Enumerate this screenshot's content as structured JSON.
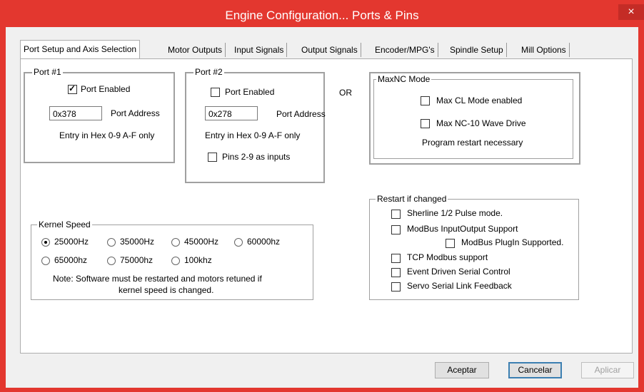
{
  "window": {
    "title": "Engine Configuration... Ports & Pins",
    "close_glyph": "×"
  },
  "tabs": [
    {
      "label": "Port Setup and Axis Selection",
      "active": true
    },
    {
      "label": "Motor Outputs"
    },
    {
      "label": "Input Signals"
    },
    {
      "label": "Output Signals"
    },
    {
      "label": "Encoder/MPG's"
    },
    {
      "label": "Spindle Setup"
    },
    {
      "label": "Mill Options"
    }
  ],
  "port1": {
    "legend": "Port #1",
    "enabled_label": "Port Enabled",
    "enabled": true,
    "address": "0x378",
    "address_label": "Port Address",
    "hint": "Entry in Hex 0-9 A-F only"
  },
  "port2": {
    "legend": "Port #2",
    "enabled_label": "Port Enabled",
    "enabled": false,
    "address": "0x278",
    "address_label": "Port Address",
    "hint": "Entry in Hex 0-9 A-F only",
    "pins_label": "Pins 2-9 as inputs",
    "pins_checked": false
  },
  "or_label": "OR",
  "maxnc": {
    "legend": "MaxNC Mode",
    "cl_label": "Max CL Mode enabled",
    "wave_label": "Max NC-10 Wave Drive",
    "note": "Program restart necessary"
  },
  "kernel": {
    "legend": "Kernel Speed",
    "options": [
      "25000Hz",
      "35000Hz",
      "45000Hz",
      "60000hz",
      "65000hz",
      "75000hz",
      "100khz"
    ],
    "selected": "25000Hz",
    "note_line1": "Note: Software must be restarted and motors retuned if",
    "note_line2": "kernel speed is changed."
  },
  "restart": {
    "legend": "Restart if changed",
    "items": [
      "Sherline 1/2 Pulse mode.",
      "ModBus InputOutput Support",
      "ModBus PlugIn Supported.",
      "TCP Modbus support",
      "Event Driven Serial Control",
      "Servo Serial Link Feedback"
    ]
  },
  "buttons": {
    "ok": "Aceptar",
    "cancel": "Cancelar",
    "apply": "Aplicar"
  },
  "colors": {
    "title_bar": "#e3372f",
    "close_button": "#c42c26",
    "dialog_bg": "#f0f0f0",
    "default_button_border": "#3c7fb1"
  }
}
